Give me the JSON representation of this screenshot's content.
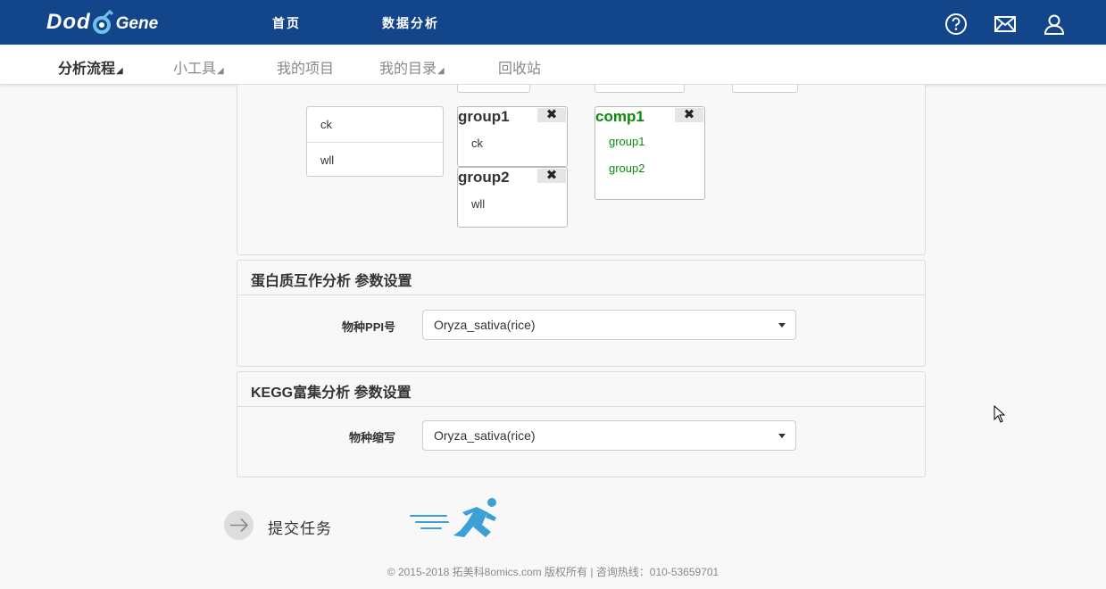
{
  "header": {
    "logo_left": "Dod",
    "logo_right": "Gene",
    "nav": [
      "首页",
      "数据分析"
    ],
    "icons": [
      "help-icon",
      "mail-icon",
      "user-icon"
    ],
    "bg_color": "#13458b"
  },
  "subnav": {
    "items": [
      {
        "label": "分析流程",
        "caret": "◢"
      },
      {
        "label": "小工具",
        "caret": "◢"
      },
      {
        "label": "我的项目",
        "caret": ""
      },
      {
        "label": "我的目录",
        "caret": "◢"
      },
      {
        "label": "回收站",
        "caret": ""
      }
    ]
  },
  "grouping": {
    "samples": [
      "ck",
      "wll"
    ],
    "groups": [
      {
        "name": "group1",
        "items": [
          "ck"
        ]
      },
      {
        "name": "group2",
        "items": [
          "wll"
        ]
      }
    ],
    "comparison": {
      "name": "comp1",
      "items": [
        "group1",
        "group2"
      ]
    },
    "close_symbol": "✖",
    "comparison_color": "#0a8a0a"
  },
  "ppi_panel": {
    "title": "蛋白质互作分析 参数设置",
    "label": "物种PPI号",
    "value": "Oryza_sativa(rice)"
  },
  "kegg_panel": {
    "title": "KEGG富集分析 参数设置",
    "label": "物种缩写",
    "value": "Oryza_sativa(rice)"
  },
  "submit": {
    "label": "提交任务",
    "icon": "arrow-right-icon",
    "accent": "#3aa0d6"
  },
  "footer": {
    "text": "© 2015-2018 拓美科8omics.com 版权所有 | 咨询热线：010-53659701"
  }
}
